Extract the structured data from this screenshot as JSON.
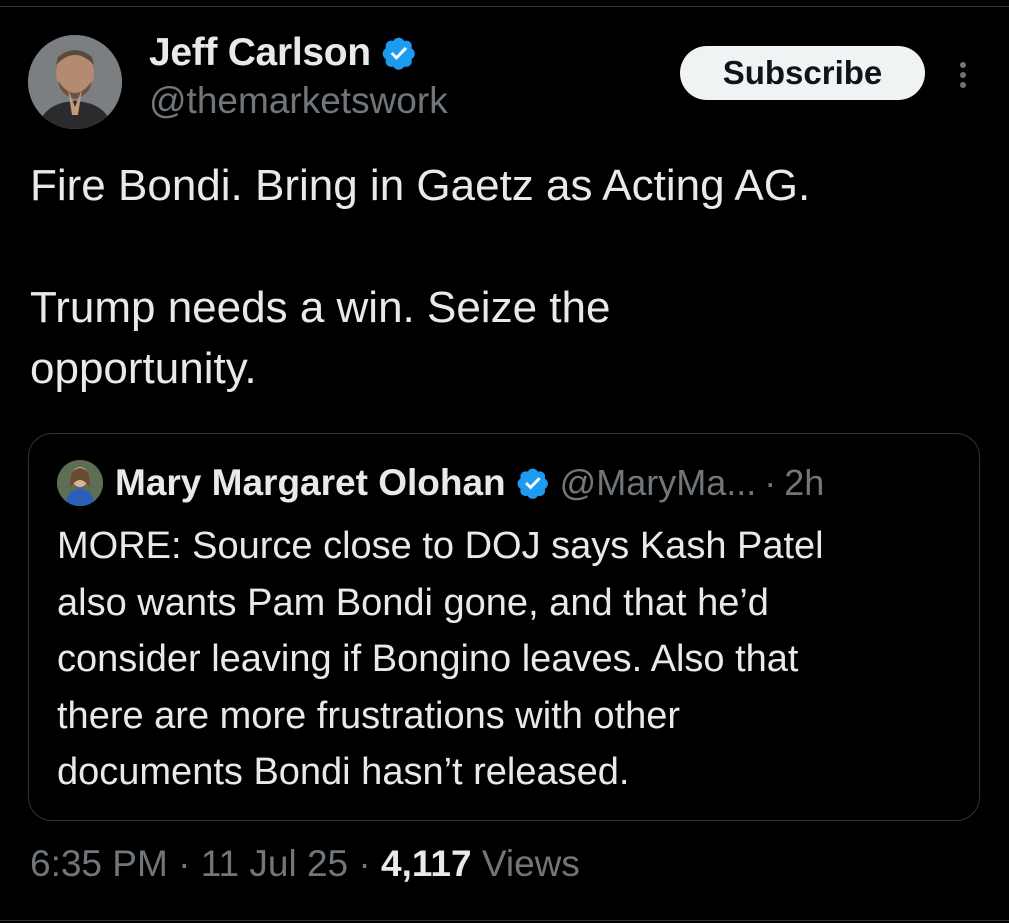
{
  "author": {
    "display_name": "Jeff Carlson",
    "handle": "@themarketswork",
    "verified_icon": "verified-badge-icon",
    "avatar_icon": "profile-photo"
  },
  "actions": {
    "subscribe_label": "Subscribe",
    "more_icon": "more-options-icon"
  },
  "tweet": {
    "paragraphs": [
      "Fire Bondi. Bring in Gaetz as Acting AG.",
      [
        "Trump needs a win. Seize the",
        "opportunity."
      ]
    ]
  },
  "quote": {
    "display_name": "Mary Margaret Olohan",
    "handle": "@MaryMa...",
    "separator": "·",
    "time": "2h",
    "text_lines": [
      "MORE: Source close to DOJ says Kash Patel",
      "also wants Pam Bondi gone, and that he’d",
      "consider leaving if Bongino leaves. Also that",
      "there are more frustrations with other",
      "documents Bondi hasn’t released."
    ]
  },
  "meta": {
    "time": "6:35 PM",
    "sep1": "·",
    "date": "11 Jul 25",
    "sep2": "·",
    "views_count": "4,117",
    "views_label": "Views"
  },
  "colors": {
    "background": "#000000",
    "text_primary": "#e7e9ea",
    "text_secondary": "#71767b",
    "verified_blue": "#1d9bf0",
    "border": "#2f3336",
    "subscribe_bg": "#eff3f4"
  }
}
